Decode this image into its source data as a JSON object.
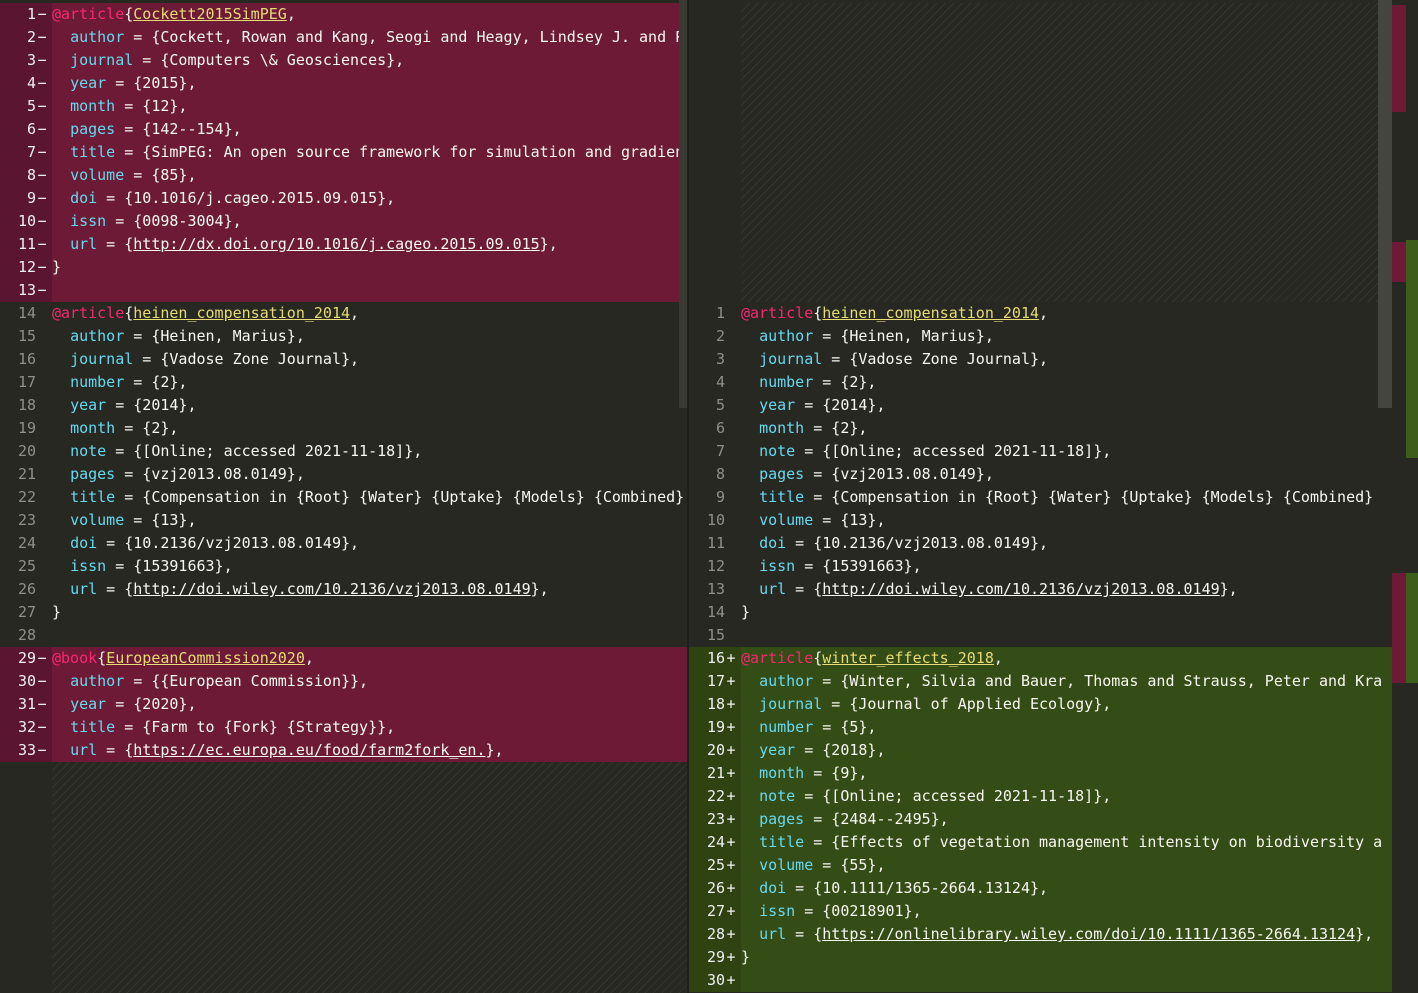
{
  "colors": {
    "background": "#272822",
    "deleted_line": "#6c1a35",
    "added_line": "#344c16",
    "keyword_at": "#f92672",
    "citation_key": "#e6db74",
    "field_name": "#66d9ef"
  },
  "left": {
    "lines": [
      {
        "n": "1",
        "m": "−",
        "t": "del",
        "at": "@article",
        "key": "Cockett2015SimPEG",
        "c": ","
      },
      {
        "n": "2",
        "m": "−",
        "t": "del",
        "f": "author",
        "c": " = {Cockett, Rowan and Kang, Seogi and Heagy, Lindsey J. and Pi"
      },
      {
        "n": "3",
        "m": "−",
        "t": "del",
        "f": "journal",
        "c": " = {Computers \\& Geosciences},"
      },
      {
        "n": "4",
        "m": "−",
        "t": "del",
        "f": "year",
        "c": " = {2015},"
      },
      {
        "n": "5",
        "m": "−",
        "t": "del",
        "f": "month",
        "c": " = {12},"
      },
      {
        "n": "6",
        "m": "−",
        "t": "del",
        "f": "pages",
        "c": " = {142--154},"
      },
      {
        "n": "7",
        "m": "−",
        "t": "del",
        "f": "title",
        "c": " = {SimPEG: An open source framework for simulation and gradient"
      },
      {
        "n": "8",
        "m": "−",
        "t": "del",
        "f": "volume",
        "c": " = {85},"
      },
      {
        "n": "9",
        "m": "−",
        "t": "del",
        "f": "doi",
        "c": " = {10.1016/j.cageo.2015.09.015},"
      },
      {
        "n": "10",
        "m": "−",
        "t": "del",
        "f": "issn",
        "c": " = {0098-3004},"
      },
      {
        "n": "11",
        "m": "−",
        "t": "del",
        "f": "url",
        "c": " = {",
        "u": "http://dx.doi.org/10.1016/j.cageo.2015.09.015",
        "c2": "},"
      },
      {
        "n": "12",
        "m": "−",
        "t": "del",
        "c": "}"
      },
      {
        "n": "13",
        "m": "−",
        "t": "del",
        "c": ""
      },
      {
        "n": "14",
        "m": "",
        "t": "ctx",
        "at": "@article",
        "key": "heinen_compensation_2014",
        "c": ","
      },
      {
        "n": "15",
        "m": "",
        "t": "ctx",
        "f": "author",
        "c": " = {Heinen, Marius},"
      },
      {
        "n": "16",
        "m": "",
        "t": "ctx",
        "f": "journal",
        "c": " = {Vadose Zone Journal},"
      },
      {
        "n": "17",
        "m": "",
        "t": "ctx",
        "f": "number",
        "c": " = {2},"
      },
      {
        "n": "18",
        "m": "",
        "t": "ctx",
        "f": "year",
        "c": " = {2014},"
      },
      {
        "n": "19",
        "m": "",
        "t": "ctx",
        "f": "month",
        "c": " = {2},"
      },
      {
        "n": "20",
        "m": "",
        "t": "ctx",
        "f": "note",
        "c": " = {[Online; accessed 2021-11-18]},"
      },
      {
        "n": "21",
        "m": "",
        "t": "ctx",
        "f": "pages",
        "c": " = {vzj2013.08.0149},"
      },
      {
        "n": "22",
        "m": "",
        "t": "ctx",
        "f": "title",
        "c": " = {Compensation in {Root} {Water} {Uptake} {Models} {Combined}"
      },
      {
        "n": "23",
        "m": "",
        "t": "ctx",
        "f": "volume",
        "c": " = {13},"
      },
      {
        "n": "24",
        "m": "",
        "t": "ctx",
        "f": "doi",
        "c": " = {10.2136/vzj2013.08.0149},"
      },
      {
        "n": "25",
        "m": "",
        "t": "ctx",
        "f": "issn",
        "c": " = {15391663},"
      },
      {
        "n": "26",
        "m": "",
        "t": "ctx",
        "f": "url",
        "c": " = {",
        "u": "http://doi.wiley.com/10.2136/vzj2013.08.0149",
        "c2": "},"
      },
      {
        "n": "27",
        "m": "",
        "t": "ctx",
        "c": "}"
      },
      {
        "n": "28",
        "m": "",
        "t": "ctx",
        "c": ""
      },
      {
        "n": "29",
        "m": "−",
        "t": "del",
        "at": "@book",
        "key": "EuropeanCommission2020",
        "c": ","
      },
      {
        "n": "30",
        "m": "−",
        "t": "del",
        "f": "author",
        "c": " = {{European Commission}},"
      },
      {
        "n": "31",
        "m": "−",
        "t": "del",
        "f": "year",
        "c": " = {2020},"
      },
      {
        "n": "32",
        "m": "−",
        "t": "del",
        "f": "title",
        "c": " = {Farm to {Fork} {Strategy}},"
      },
      {
        "n": "33",
        "m": "−",
        "t": "del",
        "f": "url",
        "c": " = {",
        "u": "https://ec.europa.eu/food/farm2fork_en.",
        "c2": "},"
      }
    ]
  },
  "right": {
    "lines": [
      {
        "n": "1",
        "m": "",
        "t": "ctx",
        "at": "@article",
        "key": "heinen_compensation_2014",
        "c": ","
      },
      {
        "n": "2",
        "m": "",
        "t": "ctx",
        "f": "author",
        "c": " = {Heinen, Marius},"
      },
      {
        "n": "3",
        "m": "",
        "t": "ctx",
        "f": "journal",
        "c": " = {Vadose Zone Journal},"
      },
      {
        "n": "4",
        "m": "",
        "t": "ctx",
        "f": "number",
        "c": " = {2},"
      },
      {
        "n": "5",
        "m": "",
        "t": "ctx",
        "f": "year",
        "c": " = {2014},"
      },
      {
        "n": "6",
        "m": "",
        "t": "ctx",
        "f": "month",
        "c": " = {2},"
      },
      {
        "n": "7",
        "m": "",
        "t": "ctx",
        "f": "note",
        "c": " = {[Online; accessed 2021-11-18]},"
      },
      {
        "n": "8",
        "m": "",
        "t": "ctx",
        "f": "pages",
        "c": " = {vzj2013.08.0149},"
      },
      {
        "n": "9",
        "m": "",
        "t": "ctx",
        "f": "title",
        "c": " = {Compensation in {Root} {Water} {Uptake} {Models} {Combined}"
      },
      {
        "n": "10",
        "m": "",
        "t": "ctx",
        "f": "volume",
        "c": " = {13},"
      },
      {
        "n": "11",
        "m": "",
        "t": "ctx",
        "f": "doi",
        "c": " = {10.2136/vzj2013.08.0149},"
      },
      {
        "n": "12",
        "m": "",
        "t": "ctx",
        "f": "issn",
        "c": " = {15391663},"
      },
      {
        "n": "13",
        "m": "",
        "t": "ctx",
        "f": "url",
        "c": " = {",
        "u": "http://doi.wiley.com/10.2136/vzj2013.08.0149",
        "c2": "},"
      },
      {
        "n": "14",
        "m": "",
        "t": "ctx",
        "c": "}"
      },
      {
        "n": "15",
        "m": "",
        "t": "ctx",
        "c": ""
      },
      {
        "n": "16",
        "m": "+",
        "t": "add",
        "at": "@article",
        "key": "winter_effects_2018",
        "c": ","
      },
      {
        "n": "17",
        "m": "+",
        "t": "add",
        "f": "author",
        "c": " = {Winter, Silvia and Bauer, Thomas and Strauss, Peter and Kra"
      },
      {
        "n": "18",
        "m": "+",
        "t": "add",
        "f": "journal",
        "c": " = {Journal of Applied Ecology},"
      },
      {
        "n": "19",
        "m": "+",
        "t": "add",
        "f": "number",
        "c": " = {5},"
      },
      {
        "n": "20",
        "m": "+",
        "t": "add",
        "f": "year",
        "c": " = {2018},"
      },
      {
        "n": "21",
        "m": "+",
        "t": "add",
        "f": "month",
        "c": " = {9},"
      },
      {
        "n": "22",
        "m": "+",
        "t": "add",
        "f": "note",
        "c": " = {[Online; accessed 2021-11-18]},"
      },
      {
        "n": "23",
        "m": "+",
        "t": "add",
        "f": "pages",
        "c": " = {2484--2495},"
      },
      {
        "n": "24",
        "m": "+",
        "t": "add",
        "f": "title",
        "c": " = {Effects of vegetation management intensity on biodiversity a"
      },
      {
        "n": "25",
        "m": "+",
        "t": "add",
        "f": "volume",
        "c": " = {55},"
      },
      {
        "n": "26",
        "m": "+",
        "t": "add",
        "f": "doi",
        "c": " = {10.1111/1365-2664.13124},"
      },
      {
        "n": "27",
        "m": "+",
        "t": "add",
        "f": "issn",
        "c": " = {00218901},"
      },
      {
        "n": "28",
        "m": "+",
        "t": "add",
        "f": "url",
        "c": " = {",
        "u": "https://onlinelibrary.wiley.com/doi/10.1111/1365-2664.13124",
        "c2": "},"
      },
      {
        "n": "29",
        "m": "+",
        "t": "add",
        "c": "}"
      },
      {
        "n": "30",
        "m": "+",
        "t": "add",
        "c": ""
      }
    ]
  }
}
